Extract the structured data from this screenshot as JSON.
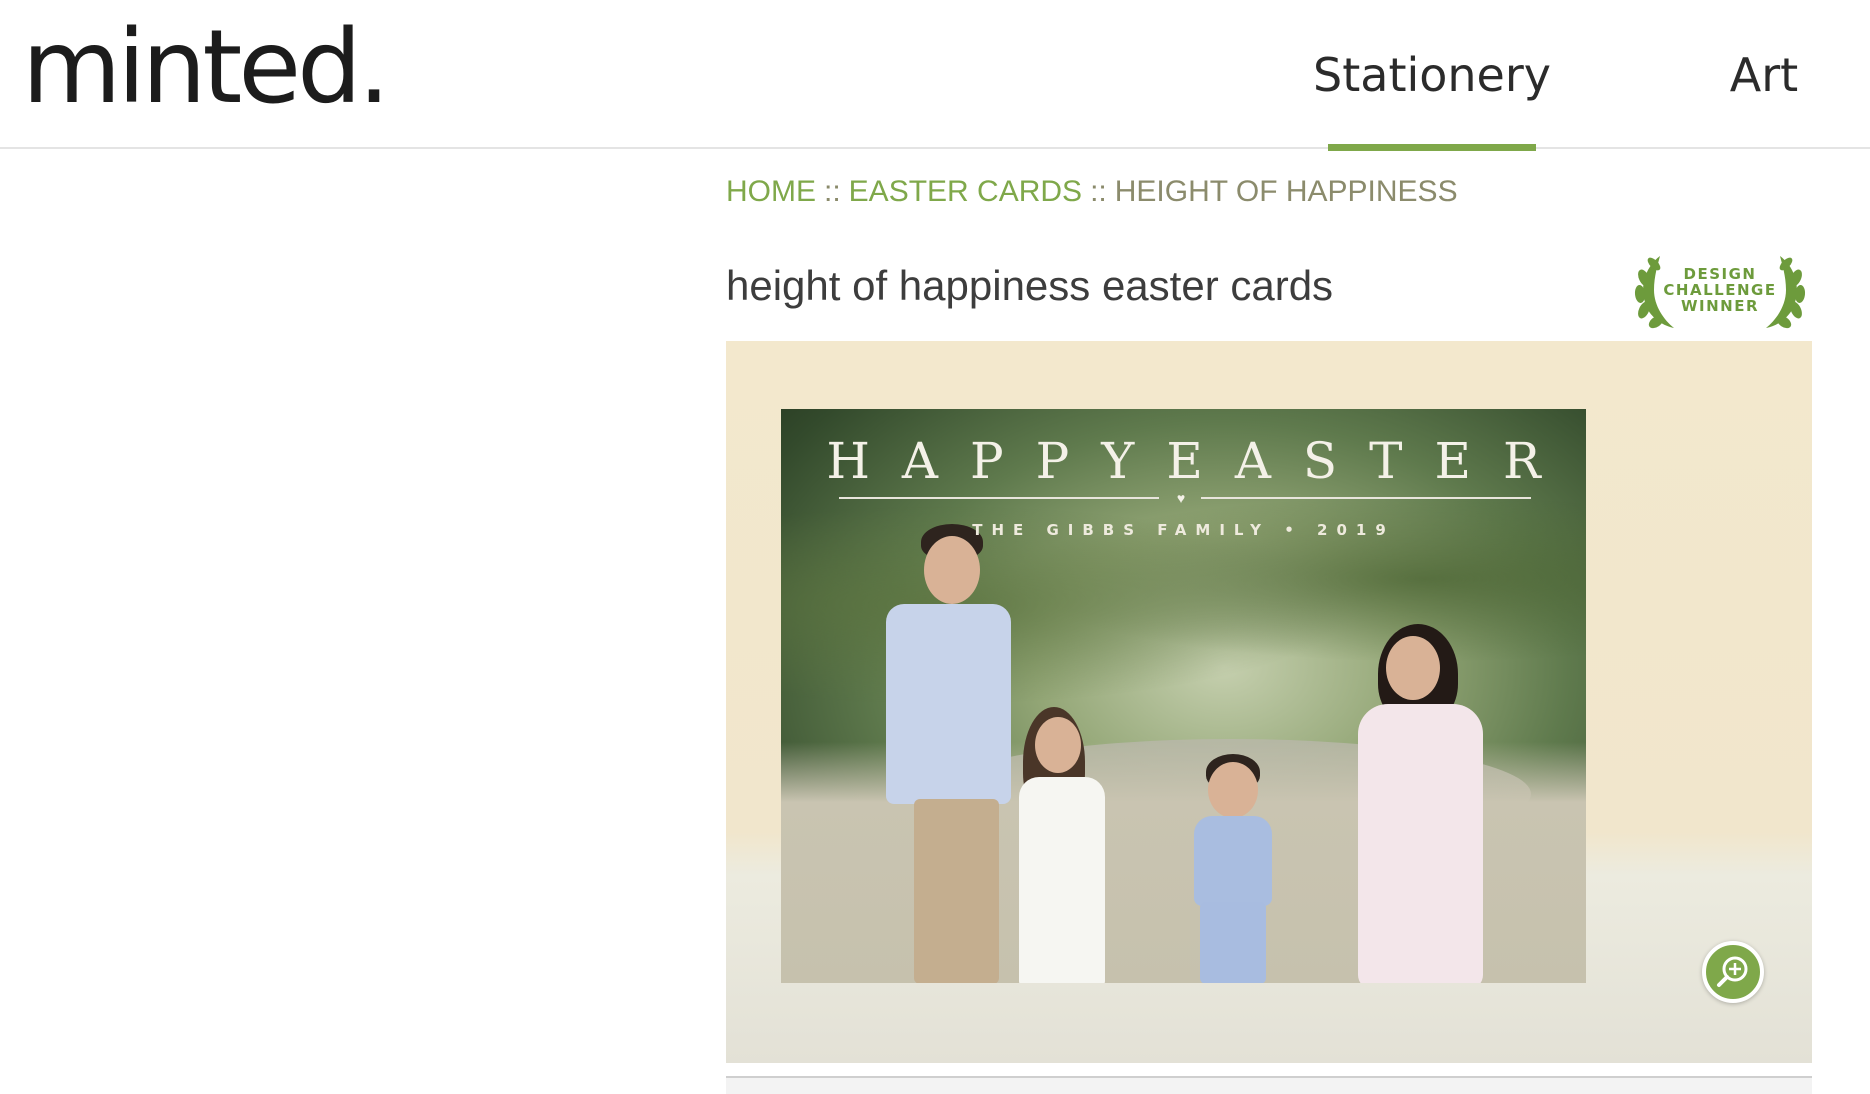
{
  "brand": {
    "logo_text": "minted."
  },
  "nav": {
    "items": [
      {
        "label": "Stationery",
        "active": true
      },
      {
        "label": "Art",
        "active": false
      }
    ]
  },
  "breadcrumb": {
    "home": "HOME",
    "separator": "::",
    "category": "EASTER CARDS",
    "current": "HEIGHT OF HAPPINESS"
  },
  "product": {
    "title": "height of happiness easter cards",
    "badge": {
      "line1": "DESIGN",
      "line2": "CHALLENGE",
      "line3": "WINNER"
    },
    "card": {
      "heading": "HAPPYEASTER",
      "subheading": "THE GIBBS FAMILY • 2019"
    },
    "zoom_icon": "zoom-in-icon"
  },
  "colors": {
    "accent": "#7fa84a",
    "breadcrumb_current": "#8b8b6c",
    "card_background": "#f3e8cd"
  }
}
